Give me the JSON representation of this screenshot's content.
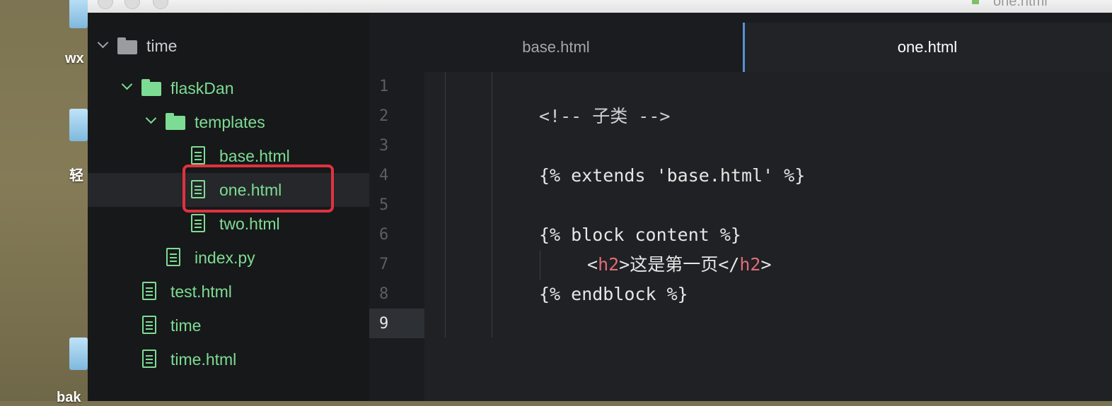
{
  "window": {
    "title": "one.html"
  },
  "desktop": {
    "labels": [
      "wx",
      "轻",
      "bak"
    ]
  },
  "sidebar": {
    "root": "time",
    "items": [
      {
        "label": "flaskDan",
        "kind": "folder"
      },
      {
        "label": "templates",
        "kind": "folder"
      },
      {
        "label": "base.html",
        "kind": "file"
      },
      {
        "label": "one.html",
        "kind": "file",
        "selected": true
      },
      {
        "label": "two.html",
        "kind": "file"
      },
      {
        "label": "index.py",
        "kind": "file"
      },
      {
        "label": "test.html",
        "kind": "file"
      },
      {
        "label": "time",
        "kind": "file"
      },
      {
        "label": "time.html",
        "kind": "file"
      }
    ]
  },
  "tabs": [
    {
      "label": "base.html",
      "active": false
    },
    {
      "label": "one.html",
      "active": true
    }
  ],
  "editor": {
    "line_numbers": [
      "1",
      "2",
      "3",
      "4",
      "5",
      "6",
      "7",
      "8",
      "9"
    ],
    "current_line": "9",
    "lines": {
      "l2": "<!-- 子类 -->",
      "l4": "{% extends 'base.html' %}",
      "l6": "{% block content %}",
      "l7_open_bracket": "<",
      "l7_tag_open": "h2",
      "l7_text": ">这是第一页</",
      "l7_tag_close": "h2",
      "l7_close_bracket": ">",
      "l8": "{% endblock %}"
    }
  },
  "colors": {
    "tree_green": "#7ddc93",
    "highlight_red": "#e0323f",
    "tab_accent": "#5b8fd6",
    "tag_red": "#e06c75"
  },
  "icons": [
    "chevron-down-icon",
    "folder-icon",
    "file-icon"
  ]
}
